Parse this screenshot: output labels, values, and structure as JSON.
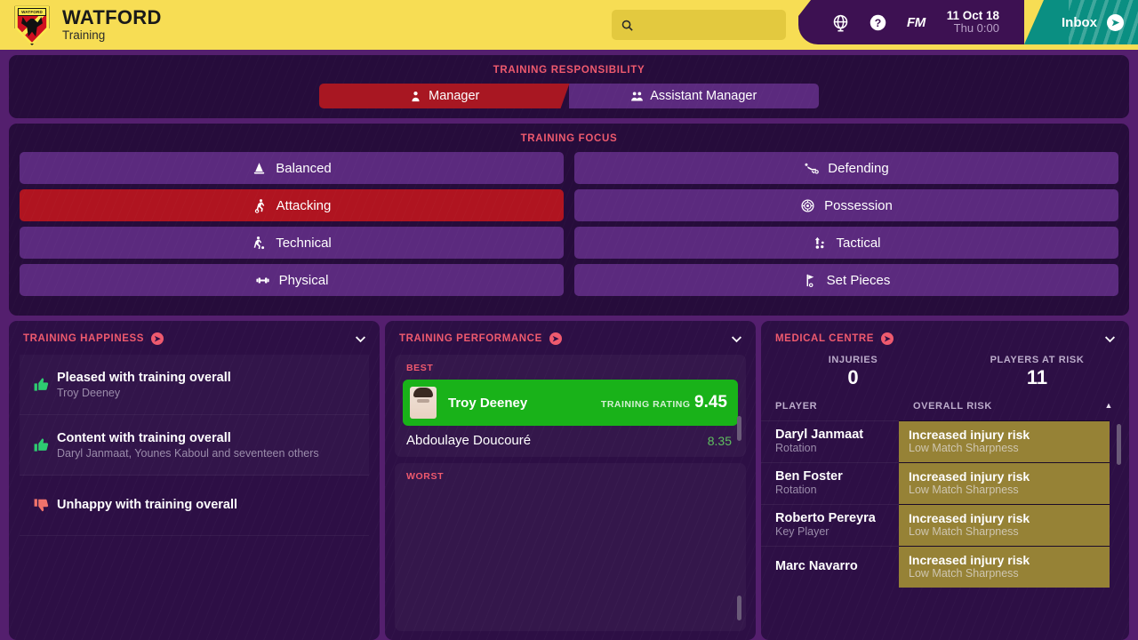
{
  "header": {
    "club_name": "WATFORD",
    "section": "Training",
    "crest_band_text": "WATFORD",
    "search_placeholder": "",
    "search_value": "",
    "icons": {
      "globe": "globe-icon",
      "help": "help-icon"
    },
    "fm_logo": "FM",
    "date_line1": "11 Oct 18",
    "date_line2": "Thu 0:00",
    "inbox_label": "Inbox"
  },
  "responsibility": {
    "heading": "TRAINING RESPONSIBILITY",
    "options": [
      {
        "label": "Manager",
        "icon": "person-icon",
        "active": true
      },
      {
        "label": "Assistant Manager",
        "icon": "people-icon",
        "active": false
      }
    ]
  },
  "focus": {
    "heading": "TRAINING FOCUS",
    "items": [
      {
        "label": "Balanced",
        "icon": "scales-icon",
        "active": false
      },
      {
        "label": "Defending",
        "icon": "tackle-icon",
        "active": false
      },
      {
        "label": "Attacking",
        "icon": "shooting-icon",
        "active": true
      },
      {
        "label": "Possession",
        "icon": "ball-icon",
        "active": false
      },
      {
        "label": "Technical",
        "icon": "dribble-icon",
        "active": false
      },
      {
        "label": "Tactical",
        "icon": "arrows-icon",
        "active": false
      },
      {
        "label": "Physical",
        "icon": "dumbbell-icon",
        "active": false
      },
      {
        "label": "Set Pieces",
        "icon": "corner-flag-icon",
        "active": false
      }
    ]
  },
  "happiness": {
    "title": "TRAINING HAPPINESS",
    "rows": [
      {
        "mood": "up",
        "main": "Pleased with training overall",
        "sub": "Troy Deeney"
      },
      {
        "mood": "up",
        "main": "Content with training overall",
        "sub": "Daryl Janmaat, Younes Kaboul and seventeen others"
      },
      {
        "mood": "down",
        "main": "Unhappy with training overall",
        "sub": ""
      }
    ]
  },
  "performance": {
    "title": "TRAINING PERFORMANCE",
    "best_label": "BEST",
    "worst_label": "WORST",
    "best": {
      "name": "Troy Deeney",
      "rating_label": "TRAINING RATING",
      "rating": "9.45"
    },
    "others": [
      {
        "name": "Abdoulaye Doucouré",
        "score": "8.35"
      }
    ],
    "worst": []
  },
  "medical": {
    "title": "MEDICAL CENTRE",
    "stats": [
      {
        "label": "INJURIES",
        "value": "0"
      },
      {
        "label": "PLAYERS AT RISK",
        "value": "11"
      }
    ],
    "columns": {
      "player": "PLAYER",
      "risk": "OVERALL RISK"
    },
    "rows": [
      {
        "name": "Daryl Janmaat",
        "role": "Rotation",
        "risk": "Increased injury risk",
        "reason": "Low Match Sharpness"
      },
      {
        "name": "Ben Foster",
        "role": "Rotation",
        "risk": "Increased injury risk",
        "reason": "Low Match Sharpness"
      },
      {
        "name": "Roberto Pereyra",
        "role": "Key Player",
        "risk": "Increased injury risk",
        "reason": "Low Match Sharpness"
      },
      {
        "name": "Marc Navarro",
        "role": "",
        "risk": "Increased injury risk",
        "reason": "Low Match Sharpness"
      }
    ]
  },
  "colors": {
    "header_yellow": "#f7dd54",
    "header_purple": "#3d1152",
    "inbox_teal": "#0a8f82",
    "page_purple": "#541f6e",
    "card_dark": "#260c3b",
    "panel_dark": "#2d0f45",
    "accent_pink": "#ef5a6e",
    "active_red": "#b01420",
    "button_purple": "#5b2a7e",
    "good_green": "#19b219",
    "risk_olive": "#968236"
  }
}
